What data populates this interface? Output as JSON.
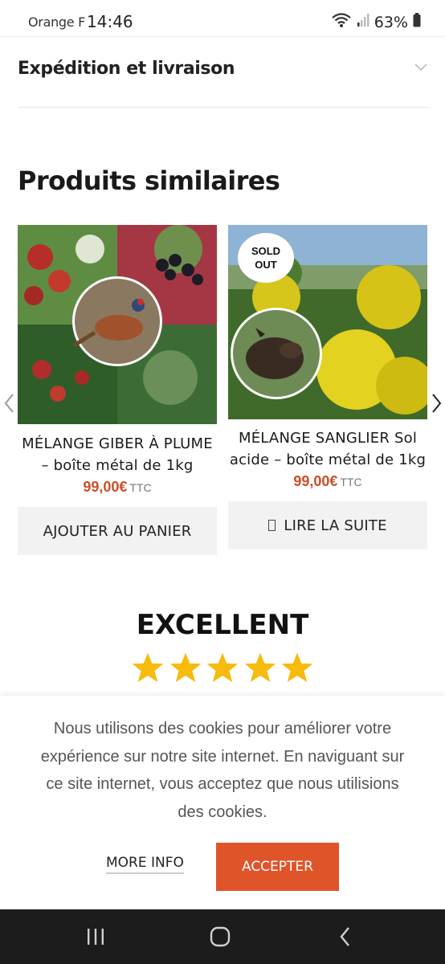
{
  "status_bar": {
    "carrier": "Orange F",
    "time": "14:46",
    "battery": "63%"
  },
  "accordion": {
    "title": "Expédition et livraison"
  },
  "section": {
    "title": "Produits similaires"
  },
  "products": [
    {
      "name": "MÉLANGE GIBER À PLUME – boîte métal de 1kg",
      "price": "99,00€",
      "price_suffix": "TTC",
      "button_label": "AJOUTER AU PANIER",
      "badge": ""
    },
    {
      "name": "MÉLANGE SANGLIER Sol acide – boîte métal de 1kg",
      "price": "99,00€",
      "price_suffix": "TTC",
      "button_label": "LIRE LA SUITE",
      "badge": "SOLD OUT"
    }
  ],
  "rating": {
    "title": "EXCELLENT",
    "stars": 5
  },
  "cookie_banner": {
    "text": "Nous utilisons des cookies pour améliorer votre expérience sur notre site internet. En naviguant sur ce site internet, vous acceptez que nous utilisions des cookies.",
    "more_info": "MORE INFO",
    "accept": "ACCEPTER"
  },
  "colors": {
    "accent": "#e0542a",
    "price": "#c8502b",
    "star": "#f6bb0d"
  }
}
